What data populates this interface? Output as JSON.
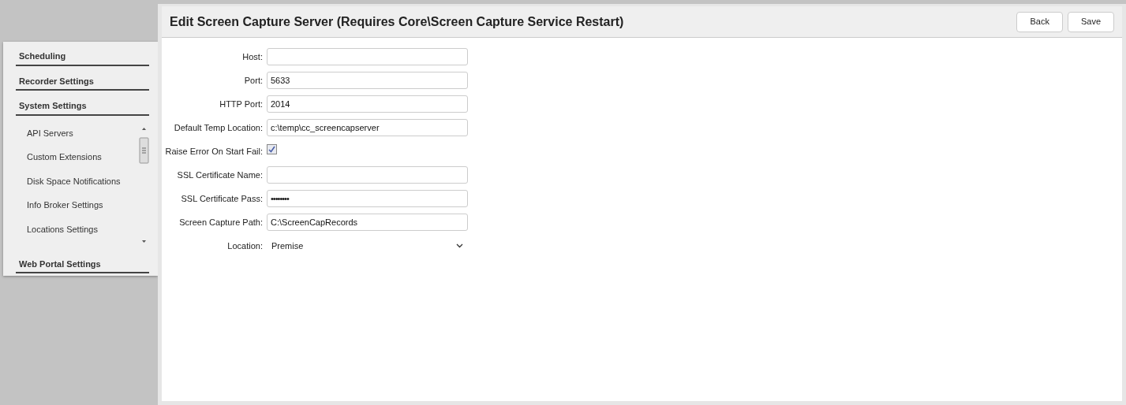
{
  "sidebar": {
    "sections": [
      {
        "label": "Scheduling"
      },
      {
        "label": "Recorder Settings"
      },
      {
        "label": "System Settings",
        "children": [
          {
            "label": "API Servers"
          },
          {
            "label": "Custom Extensions"
          },
          {
            "label": "Disk Space Notifications"
          },
          {
            "label": "Info Broker Settings"
          },
          {
            "label": "Locations Settings"
          }
        ]
      },
      {
        "label": "Web Portal Settings"
      }
    ]
  },
  "page": {
    "title": "Edit Screen Capture Server (Requires Core\\Screen Capture Service Restart)",
    "buttons": [
      "Back",
      "Save"
    ]
  },
  "form": [
    {
      "kind": "text",
      "label": "Host:"
    },
    {
      "kind": "text",
      "label": "Port:",
      "value": "5633"
    },
    {
      "kind": "text",
      "label": "HTTP Port:",
      "value": "2014"
    },
    {
      "kind": "text",
      "label": "Default Temp Location:",
      "value": "c:\\temp\\cc_screencapserver"
    },
    {
      "kind": "checkbox",
      "label": "Raise Error On Start Fail:",
      "checked": true
    },
    {
      "kind": "text",
      "label": "SSL Certificate Name:"
    },
    {
      "kind": "password",
      "label": "SSL Certificate Pass:",
      "value": "••••••••"
    },
    {
      "kind": "text",
      "label": "Screen Capture Path:",
      "value": "C:\\ScreenCapRecords"
    },
    {
      "kind": "select",
      "label": "Location:",
      "value": "Premise"
    }
  ]
}
